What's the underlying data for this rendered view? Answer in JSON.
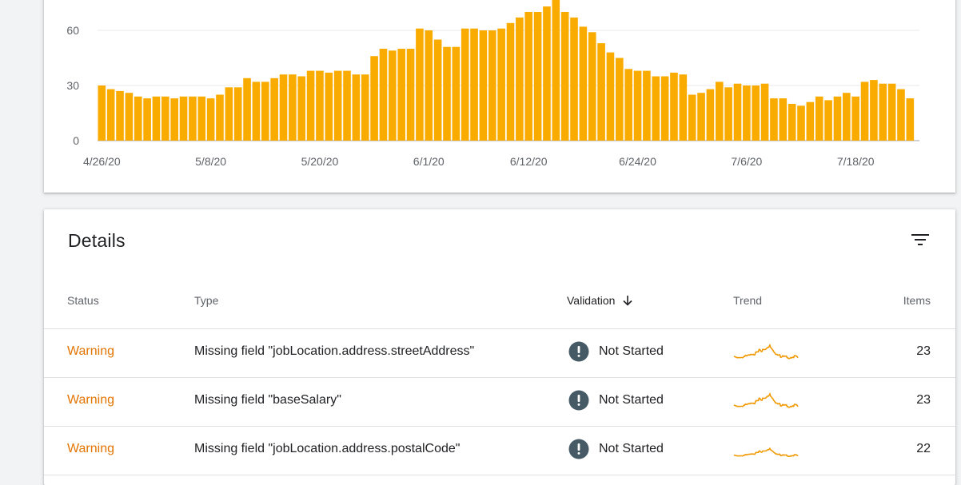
{
  "chart_data": {
    "type": "bar",
    "y_ticks": [
      0,
      30,
      60
    ],
    "ylim": [
      0,
      73
    ],
    "x_tick_labels": [
      "4/26/20",
      "5/8/20",
      "5/20/20",
      "6/1/20",
      "6/12/20",
      "6/24/20",
      "7/6/20",
      "7/18/20"
    ],
    "x_tick_day_index": [
      0,
      12,
      24,
      36,
      47,
      59,
      71,
      83
    ],
    "bar_color": "#f9ab00",
    "grid": true,
    "values": [
      30,
      28,
      27,
      26,
      24,
      23,
      24,
      24,
      23,
      24,
      24,
      24,
      23,
      25,
      29,
      29,
      34,
      32,
      32,
      34,
      36,
      36,
      35,
      38,
      38,
      37,
      38,
      38,
      36,
      36,
      46,
      50,
      49,
      50,
      50,
      61,
      60,
      55,
      51,
      51,
      61,
      61,
      60,
      60,
      61,
      64,
      67,
      70,
      70,
      73,
      80,
      70,
      67,
      62,
      59,
      53,
      48,
      45,
      39,
      38,
      38,
      35,
      35,
      37,
      36,
      25,
      26,
      28,
      32,
      29,
      31,
      30,
      30,
      31,
      23,
      23,
      20,
      19,
      21,
      24,
      22,
      24,
      26,
      24,
      32,
      33,
      31,
      31,
      28,
      23
    ]
  },
  "details": {
    "title": "Details",
    "filter_icon": "filter-icon",
    "columns": {
      "status": "Status",
      "type": "Type",
      "validation": "Validation",
      "trend": "Trend",
      "items": "Items"
    },
    "validation_sort_icon": "arrow-down-icon",
    "colors": {
      "warning": "#e37400",
      "not_started_icon": "#455a64",
      "trend_line": "#f29900"
    },
    "rows": [
      {
        "status": "Warning",
        "type": "Missing field \"jobLocation.address.streetAddress\"",
        "validation": "Not Started",
        "validation_icon": "exclamation-circle-icon",
        "items": "23"
      },
      {
        "status": "Warning",
        "type": "Missing field \"baseSalary\"",
        "validation": "Not Started",
        "validation_icon": "exclamation-circle-icon",
        "items": "23"
      },
      {
        "status": "Warning",
        "type": "Missing field \"jobLocation.address.postalCode\"",
        "validation": "Not Started",
        "validation_icon": "exclamation-circle-icon",
        "items": "22"
      }
    ]
  }
}
